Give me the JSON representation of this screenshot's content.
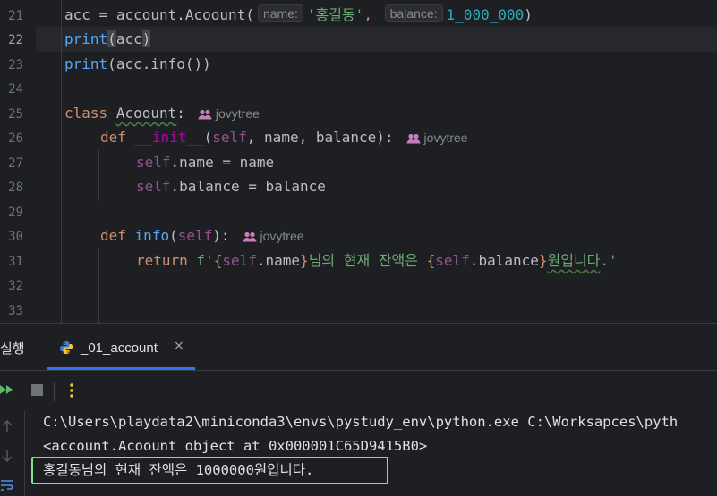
{
  "editor": {
    "line_numbers": [
      "21",
      "22",
      "23",
      "24",
      "25",
      "26",
      "27",
      "28",
      "29",
      "30",
      "31",
      "32",
      "33"
    ],
    "current_line": "22",
    "lines": {
      "l21": {
        "var": "acc",
        "eq": " = ",
        "mod": "account",
        "dot": ".",
        "cls": "Acoount",
        "open": "(",
        "hint_name": "name:",
        "str1": "'홍길동'",
        "comma": ",",
        "hint_balance": "balance:",
        "num": "1_000_000",
        "close": ")"
      },
      "l22": {
        "fn": "print",
        "open": "(",
        "arg": "acc",
        "close": ")"
      },
      "l23": {
        "fn": "print",
        "open": "(",
        "arg": "acc",
        "dot": ".",
        "method": "info",
        "call": "()",
        "close": ")"
      },
      "l25": {
        "kw": "class",
        "name": "Acoount",
        "colon": ":",
        "author": "jovytree"
      },
      "l26": {
        "kw": "def",
        "name": "__init__",
        "open": "(",
        "self": "self",
        "params": ", name, balance",
        "close": "):",
        "author": "jovytree"
      },
      "l27": {
        "self": "self",
        "rest": ".name = name"
      },
      "l28": {
        "self": "self",
        "rest": ".balance = balance"
      },
      "l30": {
        "kw": "def",
        "name": "info",
        "open": "(",
        "self": "self",
        "close": "):",
        "author": "jovytree"
      },
      "l31": {
        "kw": "return",
        "prefix": " f'",
        "b1": "{",
        "self1": "self",
        "attr1": ".name",
        "b1c": "}",
        "mid": "님의 현재 잔액은 ",
        "b2": "{",
        "self2": "self",
        "attr2": ".balance",
        "b2c": "}",
        "typo": "원입니다",
        "end": ".'"
      }
    }
  },
  "run_panel": {
    "title": "실행",
    "tab_label": "_01_account",
    "tab_close": "×",
    "icons": [
      "rerun-icon",
      "stop-icon",
      "more-options-icon",
      "scroll-up-icon",
      "scroll-down-icon",
      "soft-wrap-icon"
    ],
    "console_lines": [
      "C:\\Users\\playdata2\\miniconda3\\envs\\pystudy_env\\python.exe C:\\Worksapces\\pyth",
      "<account.Acoount object at 0x000001C65D9415B0>",
      "홍길동님의 현재 잔액은 1000000원입니다."
    ]
  },
  "colors": {
    "background": "#1e1f22",
    "keyword": "#cf8e6d",
    "function": "#56a8f5",
    "string": "#6aab73",
    "number": "#2aacb8",
    "self": "#94558d",
    "accent": "#3574f0",
    "highlight_box": "#7fe08f"
  }
}
